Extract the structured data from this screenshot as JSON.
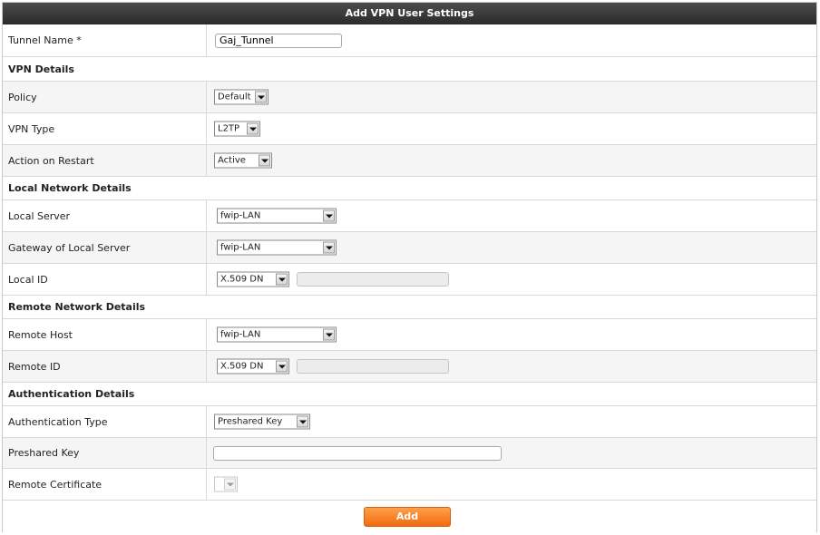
{
  "title": "Add VPN User Settings",
  "tunnel_name": {
    "label": "Tunnel Name *",
    "value": "Gaj_Tunnel"
  },
  "sections": {
    "vpn_details": "VPN Details",
    "local_network": "Local Network Details",
    "remote_network": "Remote Network Details",
    "authentication": "Authentication Details"
  },
  "policy": {
    "label": "Policy",
    "value": "Default"
  },
  "vpn_type": {
    "label": "VPN Type",
    "value": "L2TP"
  },
  "action_on_restart": {
    "label": "Action on Restart",
    "value": "Active"
  },
  "local_server": {
    "label": "Local Server",
    "value": "fwip-LAN"
  },
  "gateway_local_server": {
    "label": "Gateway of Local Server",
    "value": "fwip-LAN"
  },
  "local_id": {
    "label": "Local ID",
    "value": "X.509 DN",
    "text_value": ""
  },
  "remote_host": {
    "label": "Remote Host",
    "value": "fwip-LAN"
  },
  "remote_id": {
    "label": "Remote ID",
    "value": "X.509 DN",
    "text_value": ""
  },
  "auth_type": {
    "label": "Authentication Type",
    "value": "Preshared Key"
  },
  "preshared_key": {
    "label": "Preshared Key",
    "value": ""
  },
  "remote_certificate": {
    "label": "Remote Certificate",
    "value": ""
  },
  "add_button": "Add"
}
